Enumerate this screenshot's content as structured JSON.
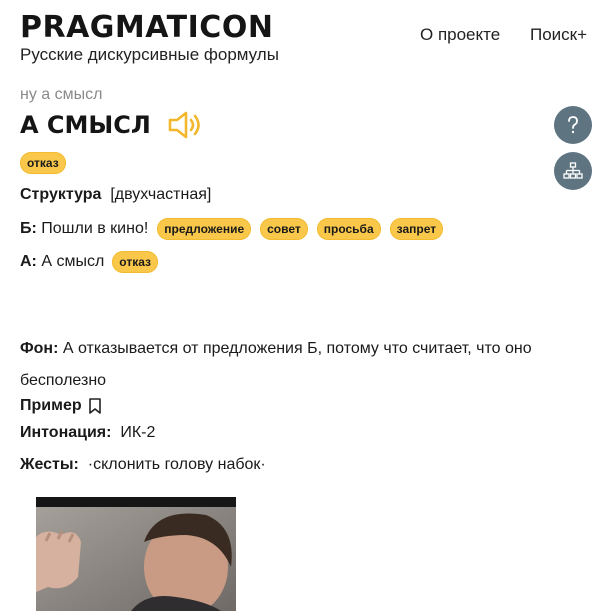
{
  "header": {
    "logo": "PRAGMATICON",
    "subtitle": "Русские дискурсивные формулы",
    "nav": {
      "about": "О проекте",
      "search": "Поиск+"
    }
  },
  "breadcrumb": "ну а смысл",
  "phrase": {
    "title": "А СМЫСЛ"
  },
  "tags": {
    "main": "отказ"
  },
  "structure": {
    "label": "Структура",
    "value": "[двухчастная]"
  },
  "dialogue": {
    "b": {
      "label": "Б:",
      "text": "Пошли в кино!",
      "tags": [
        "предложение",
        "совет",
        "просьба",
        "запрет"
      ]
    },
    "a": {
      "label": "А:",
      "text": "А смысл",
      "tags": [
        "отказ"
      ]
    }
  },
  "background": {
    "label": "Фон:",
    "text": "А отказывается от предложения Б, потому что считает, что оно бесполезно"
  },
  "example": {
    "label": "Пример"
  },
  "intonation": {
    "label": "Интонация:",
    "value": "ИК-2"
  },
  "gestures": {
    "label": "Жесты:",
    "value": "·склонить голову набок·"
  },
  "colors": {
    "tag": "#f9c84a",
    "round_button": "#5e7581",
    "icon_accent": "#f2b72b"
  },
  "icons": [
    "speaker-icon",
    "question-icon",
    "hierarchy-icon",
    "bookmark-icon"
  ]
}
